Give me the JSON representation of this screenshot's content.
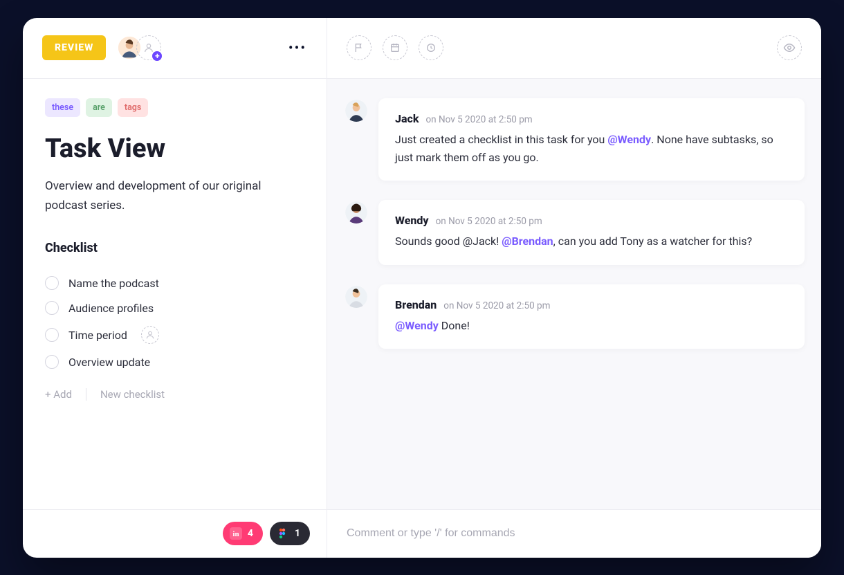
{
  "header": {
    "status_label": "REVIEW",
    "status_color": "#f5c518"
  },
  "tags": [
    {
      "text": "these",
      "variant": "purple"
    },
    {
      "text": "are",
      "variant": "green"
    },
    {
      "text": "tags",
      "variant": "red"
    }
  ],
  "task": {
    "title": "Task View",
    "description": "Overview and development of our original podcast series."
  },
  "checklist": {
    "heading": "Checklist",
    "items": [
      {
        "label": "Name the podcast",
        "assignable": false
      },
      {
        "label": "Audience profiles",
        "assignable": false
      },
      {
        "label": "Time period",
        "assignable": true
      },
      {
        "label": "Overview update",
        "assignable": false
      }
    ],
    "add_label": "+ Add",
    "new_checklist_label": "New checklist"
  },
  "integrations": {
    "invision_count": "4",
    "figma_count": "1"
  },
  "comments": [
    {
      "author": "Jack",
      "timestamp": "on Nov 5 2020 at 2:50 pm",
      "segments": [
        {
          "t": "text",
          "v": "Just created a checklist in this task for you "
        },
        {
          "t": "mention",
          "v": "@Wendy"
        },
        {
          "t": "text",
          "v": ". None have subtasks, so just mark them off as you go."
        }
      ]
    },
    {
      "author": "Wendy",
      "timestamp": "on Nov 5 2020 at 2:50 pm",
      "segments": [
        {
          "t": "text",
          "v": "Sounds good @Jack! "
        },
        {
          "t": "mention",
          "v": "@Brendan"
        },
        {
          "t": "text",
          "v": ", can you add Tony as a watcher for this?"
        }
      ]
    },
    {
      "author": "Brendan",
      "timestamp": "on Nov 5 2020 at 2:50 pm",
      "segments": [
        {
          "t": "mention",
          "v": "@Wendy"
        },
        {
          "t": "text",
          "v": " Done!"
        }
      ]
    }
  ],
  "composer": {
    "placeholder": "Comment or type '/' for commands"
  }
}
